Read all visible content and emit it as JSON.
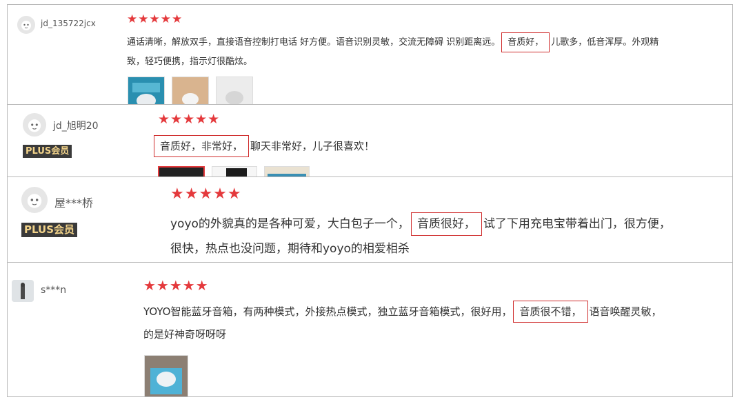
{
  "reviews": [
    {
      "user": "jd_135722jcx",
      "badge": "",
      "stars": "★★★★★",
      "line1_pre": "通话清晰，解放双手，直接语音控制打电话 好方便。语音识别灵敏，交流无障碍 识别距离远。",
      "line1_hl": "音质好，",
      "line1_post": "儿歌多，低音浑厚。外观精",
      "line2": "致，轻巧便携，指示灯很酷炫。"
    },
    {
      "user": "jd_旭明20",
      "badge": "PLUS会员",
      "stars": "★★★★★",
      "line1_pre": "",
      "line1_hl": "音质好，非常好，",
      "line1_post": "聊天非常好，儿子很喜欢！",
      "line2": ""
    },
    {
      "user": "屋***桥",
      "badge": "PLUS会员",
      "stars": "★★★★★",
      "line1_pre": "yoyo的外貌真的是各种可爱，大白包子一个，",
      "line1_hl": "音质很好，",
      "line1_post": "试了下用充电宝带着出门，很方便，",
      "line2": "很快，热点也没问题，期待和yoyo的相爱相杀"
    },
    {
      "user": "s***n",
      "badge": "",
      "stars": "★★★★★",
      "line1_pre": "YOYO智能蓝牙音箱，有两种模式，外接热点模式，独立蓝牙音箱模式，很好用，",
      "line1_hl": "音质很不错，",
      "line1_post": "语音唤醒灵敏，",
      "line2": "的是好神奇呀呀呀"
    }
  ],
  "colors": {
    "star": "#e4393c",
    "highlight_border": "#cf2a2a",
    "plus_bg": "#3a3a3a",
    "plus_text": "#f2d38a"
  },
  "icons": {
    "avatar": "default-avatar-icon",
    "star": "star-icon"
  }
}
